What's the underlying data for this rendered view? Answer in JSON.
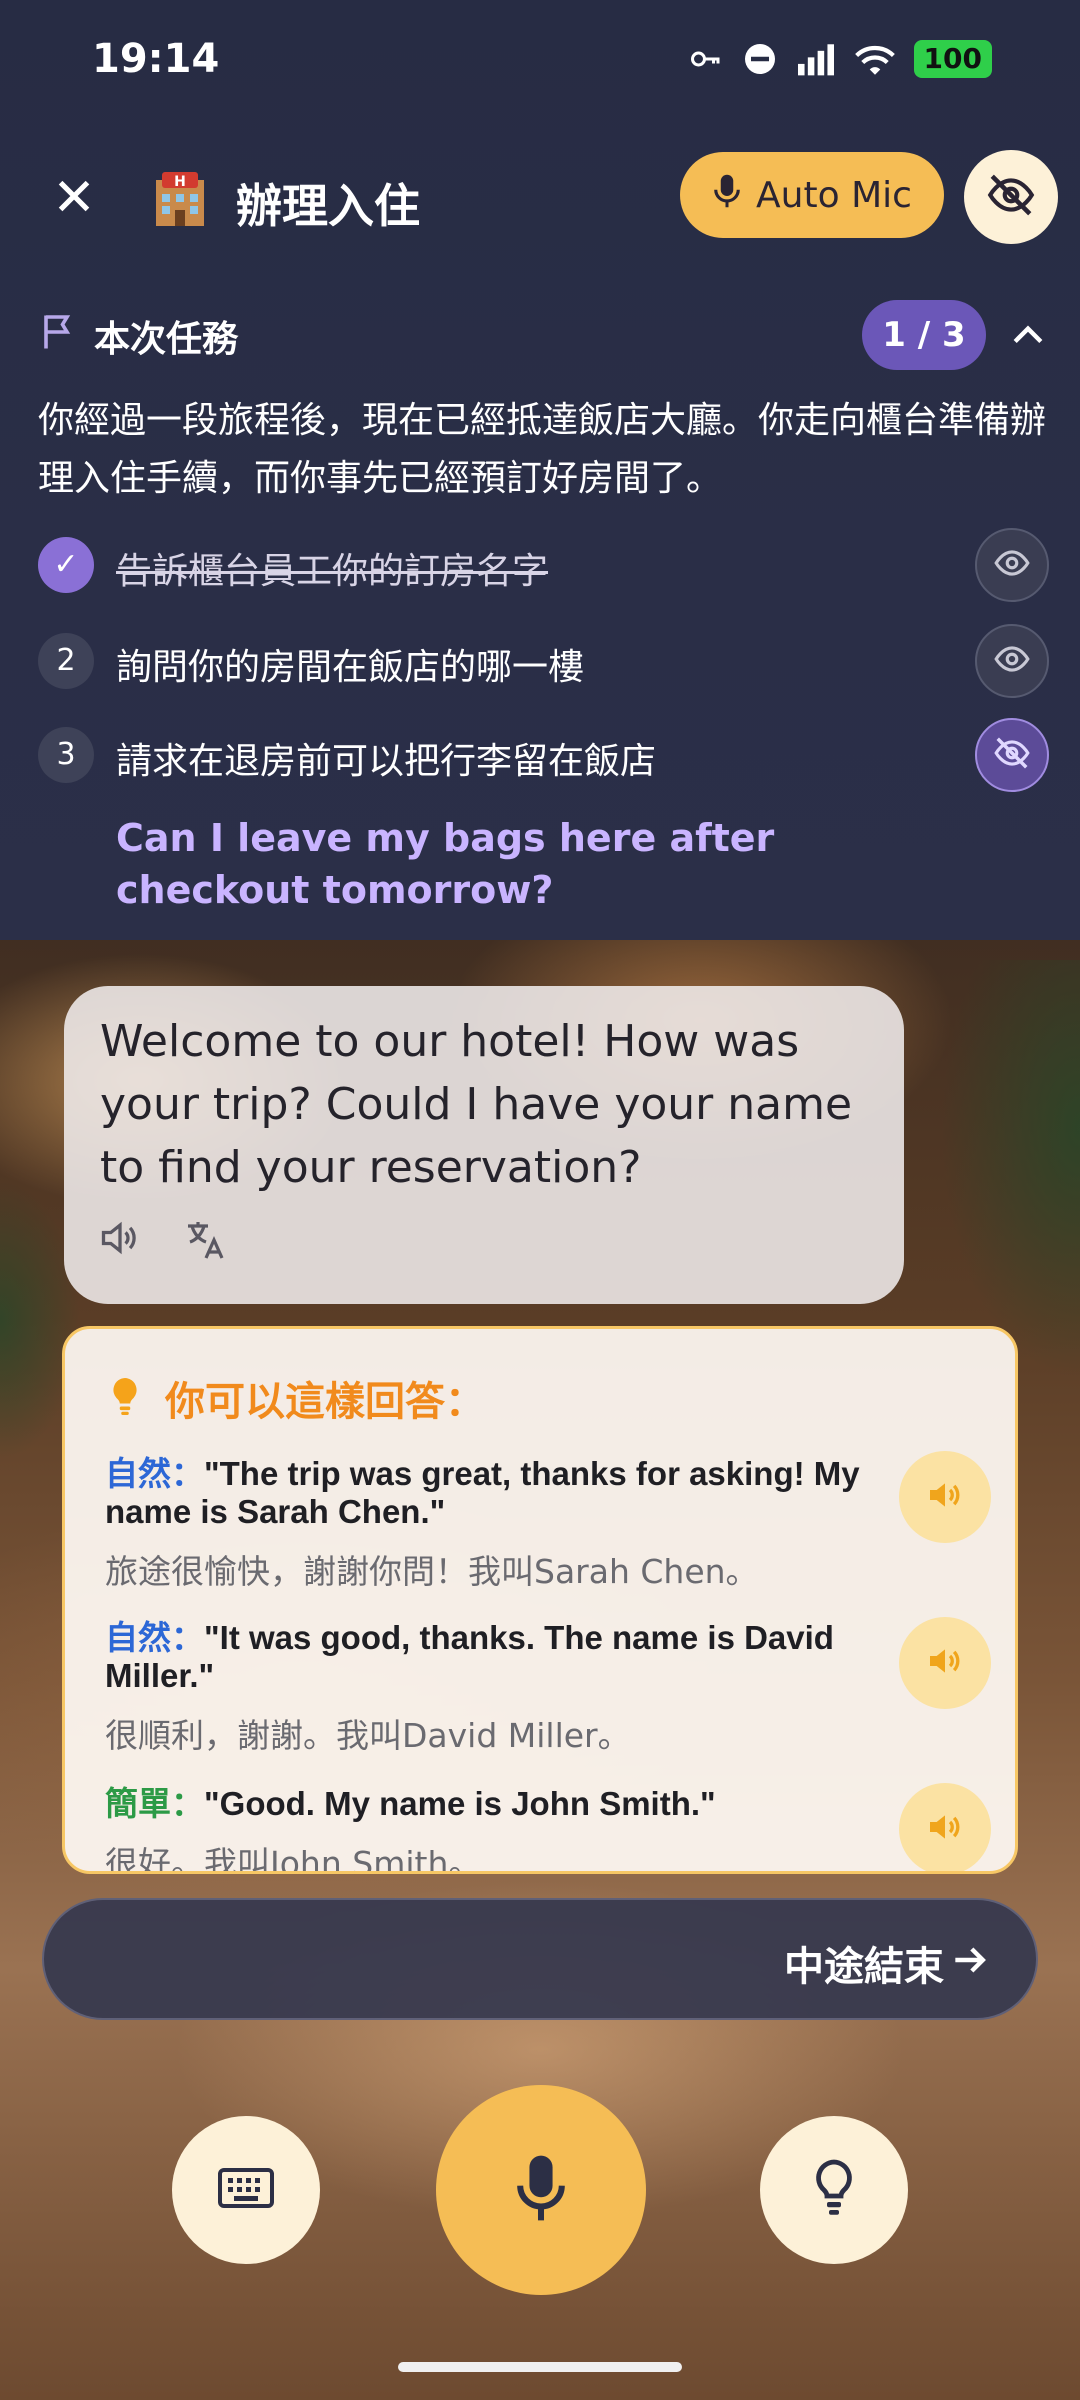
{
  "status_bar": {
    "time": "19:14",
    "battery": "100"
  },
  "header": {
    "title": "辦理入住",
    "auto_mic_label": "Auto Mic"
  },
  "task": {
    "title": "本次任務",
    "progress": "1 / 3",
    "description": "你經過一段旅程後，現在已經抵達飯店大廳。你走向櫃台準備辦理入住手續，而你事先已經預訂好房間了。",
    "items": [
      {
        "number": "✓",
        "text": "告訴櫃台員工你的訂房名字",
        "done": true
      },
      {
        "number": "2",
        "text": "詢問你的房間在飯店的哪一樓",
        "done": false
      },
      {
        "number": "3",
        "text": "請求在退房前可以把行李留在飯店",
        "done": false
      }
    ],
    "hint": "Can I leave my bags here after checkout tomorrow?"
  },
  "chat": {
    "message": "Welcome to our hotel! How was your trip? Could I have your name to find your reservation?"
  },
  "suggestions": {
    "title": "你可以這樣回答：",
    "items": [
      {
        "tag": "自然：",
        "en": "\"The trip was great, thanks for asking! My name is Sarah Chen.\"",
        "zh": "旅途很愉快，謝謝你問！我叫Sarah Chen。"
      },
      {
        "tag": "自然：",
        "en": "\"It was good, thanks. The name is David Miller.\"",
        "zh": "很順利，謝謝。我叫David Miller。"
      },
      {
        "tag": "簡單：",
        "en": "\"Good. My name is John Smith.\"",
        "zh": "很好。我叫John Smith。"
      }
    ]
  },
  "end_button": {
    "label": "中途結束"
  },
  "colors": {
    "accent": "#f5bd55",
    "panel": "#2a2e47",
    "purple": "#8a70d6",
    "suggestion_title": "#f18a1c"
  }
}
